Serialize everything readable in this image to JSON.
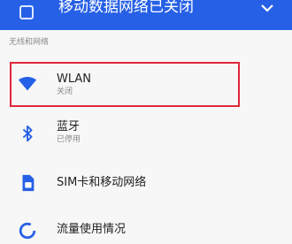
{
  "banner": {
    "text": "移动数据网络已关闭",
    "icon": "mobile-data-off-icon",
    "expand_icon": "chevron-down-icon",
    "color": "#2660e6"
  },
  "section": {
    "header": "无线和网络"
  },
  "items": [
    {
      "title": "WLAN",
      "subtitle": "关闭",
      "icon": "wifi-icon"
    },
    {
      "title": "蓝牙",
      "subtitle": "已停用",
      "icon": "bluetooth-icon"
    },
    {
      "title": "SIM卡和移动网络",
      "icon": "sim-card-icon"
    },
    {
      "title": "流量使用情况",
      "icon": "data-usage-icon"
    }
  ],
  "accent_color": "#2660e6",
  "highlight_color": "#e0263a"
}
